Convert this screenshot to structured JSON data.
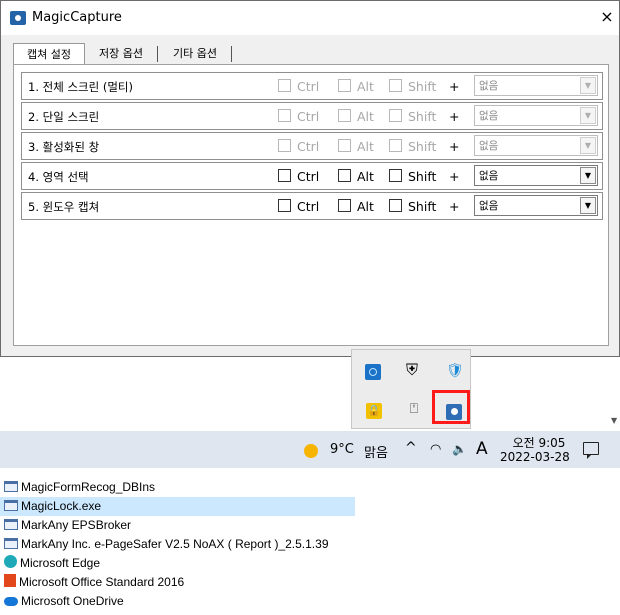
{
  "window": {
    "title": "MagicCapture",
    "close_glyph": "×",
    "tabs": [
      "캡쳐 설정",
      "저장 옵션",
      "기타 옵션"
    ],
    "rows": [
      {
        "label": "1. 전체 스크린 (멀티)",
        "ctrl": "Ctrl",
        "alt": "Alt",
        "shift": "Shift",
        "plus": "+",
        "key": "없음",
        "enabled": false
      },
      {
        "label": "2. 단일 스크린",
        "ctrl": "Ctrl",
        "alt": "Alt",
        "shift": "Shift",
        "plus": "+",
        "key": "없음",
        "enabled": false
      },
      {
        "label": "3. 활성화된 창",
        "ctrl": "Ctrl",
        "alt": "Alt",
        "shift": "Shift",
        "plus": "+",
        "key": "없음",
        "enabled": false
      },
      {
        "label": "4. 영역 선택",
        "ctrl": "Ctrl",
        "alt": "Alt",
        "shift": "Shift",
        "plus": "+",
        "key": "없음",
        "enabled": true
      },
      {
        "label": "5. 윈도우 캡쳐",
        "ctrl": "Ctrl",
        "alt": "Alt",
        "shift": "Shift",
        "plus": "+",
        "key": "없음",
        "enabled": true
      }
    ]
  },
  "tray_popup": {
    "icons": [
      "app-icon",
      "shield-cross-icon",
      "defender-icon",
      "lock-icon",
      "usb-icon",
      "camera-icon"
    ],
    "highlighted": "camera-icon",
    "highlight_color": "#ff1a1a"
  },
  "taskbar": {
    "temperature": "9°C",
    "weather": "맑음",
    "chevron": "^",
    "ime": "A",
    "time": "오전 9:05",
    "date": "2022-03-28"
  },
  "program_list": [
    {
      "name": "MagicFormRecog_DBIns",
      "icon": "exe-icon",
      "selected": false
    },
    {
      "name": "MagicLock.exe",
      "icon": "exe-icon",
      "selected": true
    },
    {
      "name": "MarkAny EPSBroker",
      "icon": "exe-icon",
      "selected": false
    },
    {
      "name": "MarkAny Inc. e-PageSafer V2.5 NoAX ( Report )_2.5.1.39",
      "icon": "exe-icon",
      "selected": false
    },
    {
      "name": "Microsoft Edge",
      "icon": "edge-icon",
      "selected": false
    },
    {
      "name": "Microsoft Office Standard 2016",
      "icon": "office-icon",
      "selected": false
    },
    {
      "name": "Microsoft OneDrive",
      "icon": "onedrive-icon",
      "selected": false
    }
  ]
}
